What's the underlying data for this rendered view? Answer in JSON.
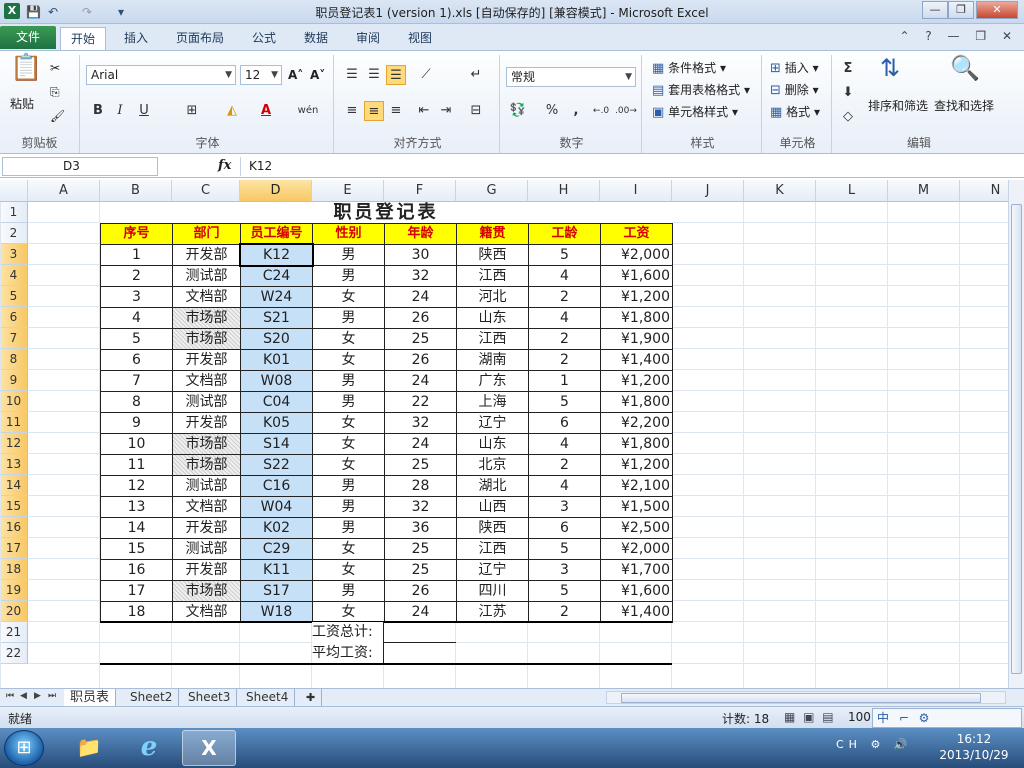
{
  "window": {
    "title": "职员登记表1 (version 1).xls [自动保存的] [兼容模式] - Microsoft Excel",
    "app_icon": "X",
    "qa_save": "💾",
    "qa_undo": "↶",
    "qa_redo": "↷",
    "qa_customize": "▾",
    "minimize": "—",
    "restore": "❐",
    "close": "✕"
  },
  "tabs": [
    "文件",
    "开始",
    "插入",
    "页面布局",
    "公式",
    "数据",
    "审阅",
    "视图"
  ],
  "tabs_right": "⌃ ? — ❐ ✕",
  "ribbon": {
    "clipboard": {
      "label": "剪贴板",
      "paste": "粘贴",
      "cut": "✂",
      "copy": "⎘",
      "format_painter": "🖌"
    },
    "font": {
      "label": "字体",
      "name": "Arial",
      "size": "12",
      "grow": "A˄",
      "shrink": "A˅",
      "bold": "B",
      "italic": "I",
      "underline": "U",
      "border": "⊞",
      "fill": "◭",
      "color": "A",
      "phonetic": "wén"
    },
    "alignment": {
      "label": "对齐方式"
    },
    "number": {
      "label": "数字",
      "format": "常规",
      "currency": "💱",
      "percent": "%",
      "comma": ",",
      "inc": "←.0",
      "dec": ".00→"
    },
    "styles": {
      "label": "样式",
      "conditional": "条件格式",
      "table": "套用表格格式",
      "cell": "单元格样式"
    },
    "cells": {
      "label": "单元格",
      "insert": "插入",
      "delete": "删除",
      "format": "格式"
    },
    "editing": {
      "label": "编辑",
      "sum": "Σ",
      "fill": "⬇",
      "clear": "◇",
      "sort": "排序和筛选",
      "find": "查找和选择"
    }
  },
  "formula_bar": {
    "name_box": "D3",
    "fx": "fx",
    "content": "K12"
  },
  "columns": [
    "A",
    "B",
    "C",
    "D",
    "E",
    "F",
    "G",
    "H",
    "I",
    "J",
    "K",
    "L",
    "M",
    "N"
  ],
  "rows": [
    "1",
    "2",
    "3",
    "4",
    "5",
    "6",
    "7",
    "8",
    "9",
    "10",
    "11",
    "12",
    "13",
    "14",
    "15",
    "16",
    "17",
    "18",
    "19",
    "20",
    "21",
    "22"
  ],
  "sheet": {
    "title": "职员登记表",
    "headers": [
      "序号",
      "部门",
      "员工编号",
      "性别",
      "年龄",
      "籍贯",
      "工龄",
      "工资"
    ],
    "records": [
      [
        "1",
        "开发部",
        "K12",
        "男",
        "30",
        "陕西",
        "5",
        "¥2,000"
      ],
      [
        "2",
        "测试部",
        "C24",
        "男",
        "32",
        "江西",
        "4",
        "¥1,600"
      ],
      [
        "3",
        "文档部",
        "W24",
        "女",
        "24",
        "河北",
        "2",
        "¥1,200"
      ],
      [
        "4",
        "市场部",
        "S21",
        "男",
        "26",
        "山东",
        "4",
        "¥1,800"
      ],
      [
        "5",
        "市场部",
        "S20",
        "女",
        "25",
        "江西",
        "2",
        "¥1,900"
      ],
      [
        "6",
        "开发部",
        "K01",
        "女",
        "26",
        "湖南",
        "2",
        "¥1,400"
      ],
      [
        "7",
        "文档部",
        "W08",
        "男",
        "24",
        "广东",
        "1",
        "¥1,200"
      ],
      [
        "8",
        "测试部",
        "C04",
        "男",
        "22",
        "上海",
        "5",
        "¥1,800"
      ],
      [
        "9",
        "开发部",
        "K05",
        "女",
        "32",
        "辽宁",
        "6",
        "¥2,200"
      ],
      [
        "10",
        "市场部",
        "S14",
        "女",
        "24",
        "山东",
        "4",
        "¥1,800"
      ],
      [
        "11",
        "市场部",
        "S22",
        "女",
        "25",
        "北京",
        "2",
        "¥1,200"
      ],
      [
        "12",
        "测试部",
        "C16",
        "男",
        "28",
        "湖北",
        "4",
        "¥2,100"
      ],
      [
        "13",
        "文档部",
        "W04",
        "男",
        "32",
        "山西",
        "3",
        "¥1,500"
      ],
      [
        "14",
        "开发部",
        "K02",
        "男",
        "36",
        "陕西",
        "6",
        "¥2,500"
      ],
      [
        "15",
        "测试部",
        "C29",
        "女",
        "25",
        "江西",
        "5",
        "¥2,000"
      ],
      [
        "16",
        "开发部",
        "K11",
        "女",
        "25",
        "辽宁",
        "3",
        "¥1,700"
      ],
      [
        "17",
        "市场部",
        "S17",
        "男",
        "26",
        "四川",
        "5",
        "¥1,600"
      ],
      [
        "18",
        "文档部",
        "W18",
        "女",
        "24",
        "江苏",
        "2",
        "¥1,400"
      ]
    ],
    "total_label": "工资总计:",
    "avg_label": "平均工资:"
  },
  "sheet_tabs": [
    "职员表",
    "Sheet2",
    "Sheet3",
    "Sheet4"
  ],
  "sheet_nav": [
    "⏮",
    "◀",
    "▶",
    "⏭"
  ],
  "status": {
    "ready": "就绪",
    "count": "计数: 18",
    "views": "▦ ▣ ▤",
    "zoom": "100",
    "ime": "中 ⌐ ⚙"
  },
  "taskbar": {
    "start": "⊞",
    "explorer": "📁",
    "ie": "e",
    "excel": "X",
    "tray": "CH ⚙ 🔊",
    "time": "16:12",
    "date": "2013/10/29"
  },
  "colors": {
    "header_fill": "#ffff00",
    "header_text": "#d40000",
    "selected_col": "#c6e0f7",
    "excel_green": "#1f7244"
  }
}
